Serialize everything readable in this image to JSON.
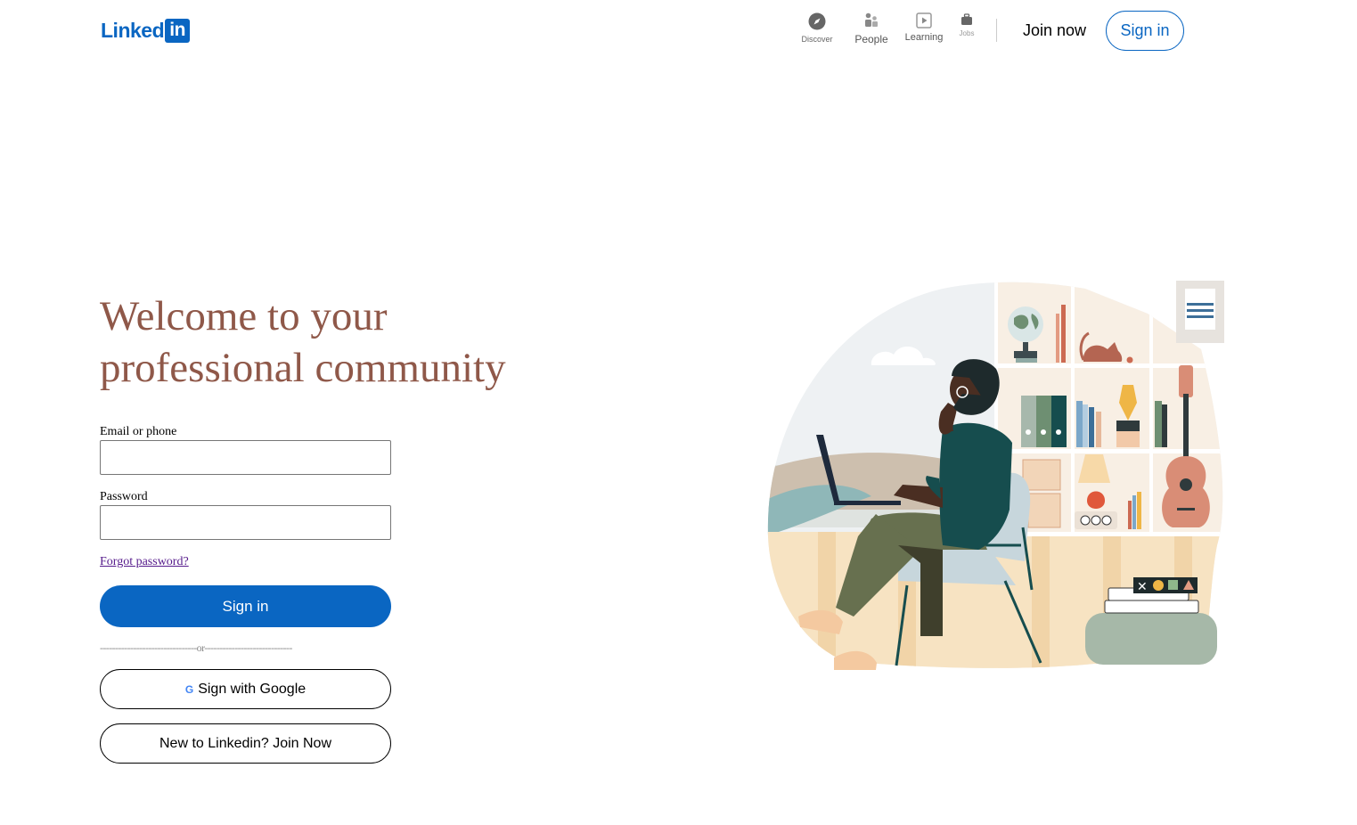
{
  "header": {
    "logo_text": "Linked",
    "logo_box": "in",
    "nav": [
      {
        "label": "Discover",
        "icon": "compass-icon"
      },
      {
        "label": "People",
        "icon": "people-icon"
      },
      {
        "label": "Learning",
        "icon": "play-icon"
      },
      {
        "label": "Jobs",
        "icon": "briefcase-icon"
      }
    ],
    "join_now": "Join now",
    "sign_in": "Sign in"
  },
  "main": {
    "headline": "Welcome to your professional community",
    "email_label": "Email or phone",
    "email_value": "",
    "password_label": "Password",
    "password_value": "",
    "forgot_password": "Forgot password?",
    "sign_in_button": "Sign in",
    "or_divider": "--------------------------------or-----------------------------",
    "google_icon": "G",
    "google_button": "Sign with Google",
    "join_button": "New to Linkedin? Join Now"
  },
  "colors": {
    "brand": "#0a66c2",
    "headline": "#8f5849"
  }
}
